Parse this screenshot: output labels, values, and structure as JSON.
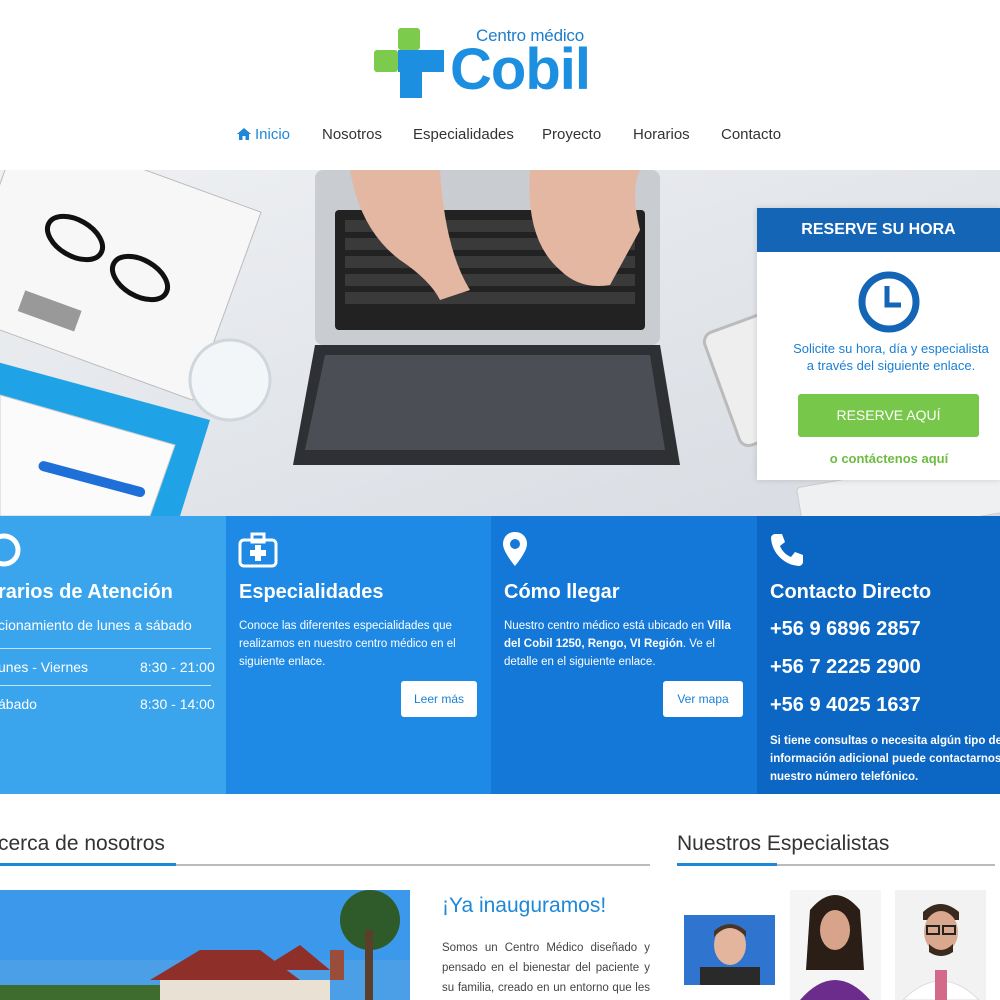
{
  "logo": {
    "small_text": "Centro médico",
    "big_text": "Cobil"
  },
  "nav": [
    {
      "label": "Inicio",
      "active": true
    },
    {
      "label": "Nosotros"
    },
    {
      "label": "Especialidades"
    },
    {
      "label": "Proyecto"
    },
    {
      "label": "Horarios"
    },
    {
      "label": "Contacto"
    }
  ],
  "reserve": {
    "title": "RESERVE SU HORA",
    "text_line1": "Solicite su hora, día y especialista",
    "text_line2": "a través del siguiente enlace.",
    "button": "RESERVE AQUÍ",
    "contact_link": "o contáctenos aquí"
  },
  "horarios": {
    "title": "rarios de Atención",
    "subtitle": "cionamiento de lunes a sábado",
    "rows": [
      {
        "day": "unes - Viernes",
        "hours": "8:30 - 21:00"
      },
      {
        "day": "ábado",
        "hours": "8:30 - 14:00"
      }
    ]
  },
  "especialidades": {
    "title": "Especialidades",
    "text_line1": "Conoce las diferentes especialidades que",
    "text_line2": "realizamos en nuestro centro médico en el",
    "text_line3": "siguiente enlace.",
    "button": "Leer más"
  },
  "como_llegar": {
    "title": "Cómo llegar",
    "text_line1_a": "Nuestro centro médico está ubicado en ",
    "text_line1_b": "Villa",
    "text_line2_a": "del Cobil 1250, Rengo, VI Región",
    "text_line2_b": ". Ve el",
    "text_line3": "detalle en el siguiente enlace.",
    "button": "Ver mapa"
  },
  "contacto": {
    "title": "Contacto Directo",
    "phones": [
      "+56 9 6896 2857",
      "+56 7 2225 2900",
      "+56 9 4025 1637"
    ],
    "text_line1": "Si tiene consultas o necesita algún tipo de",
    "text_line2": "información adicional puede contactarnos a",
    "text_line3": "nuestro número telefónico."
  },
  "acerca": {
    "title": "cerca de nosotros"
  },
  "news": {
    "title": "¡Ya inauguramos!",
    "text": "Somos un Centro Médico diseñado y pensado en el bienestar del paciente y su familia, creado en un entorno que les permita contar con las mejores"
  },
  "especialistas": {
    "title": "Nuestros Especialistas"
  },
  "colors": {
    "brand_blue": "#1d8fe0",
    "brand_green": "#77c74a",
    "dark_blue": "#1565b7"
  },
  "icons": [
    "home-icon",
    "clock-icon",
    "medkit-icon",
    "map-pin-icon",
    "phone-icon",
    "cross-logo-icon"
  ]
}
